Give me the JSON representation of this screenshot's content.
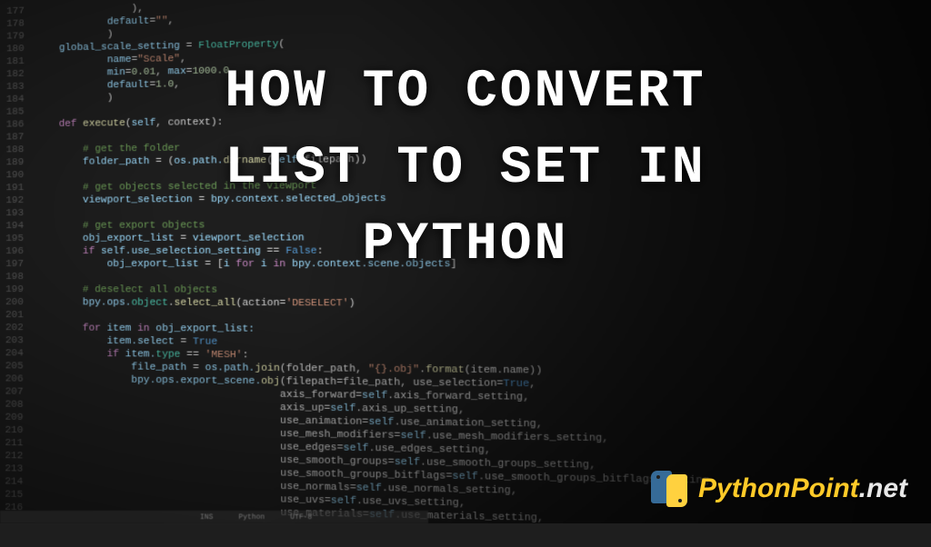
{
  "title": {
    "line1": "HOW TO CONVERT",
    "line2": "LIST TO SET IN",
    "line3": "PYTHON"
  },
  "logo": {
    "brand": "PythonPoint",
    "tld": ".net"
  },
  "statusbar": {
    "s1": "INS",
    "s2": "Python",
    "s3": "UTF-8"
  },
  "gutter": {
    "start": 177,
    "end": 216
  },
  "code": [
    {
      "i": 0,
      "tokens": [
        {
          "t": "                ",
          "c": ""
        },
        {
          "t": ")",
          "c": "op"
        },
        {
          "t": ",",
          "c": "op"
        }
      ]
    },
    {
      "i": 0,
      "tokens": [
        {
          "t": "            ",
          "c": ""
        },
        {
          "t": "default",
          "c": "prop"
        },
        {
          "t": "=",
          "c": "op"
        },
        {
          "t": "\"\"",
          "c": "str"
        },
        {
          "t": ",",
          "c": "op"
        }
      ]
    },
    {
      "i": 0,
      "tokens": [
        {
          "t": "            ",
          "c": ""
        },
        {
          "t": ")",
          "c": "op"
        }
      ]
    },
    {
      "i": 0,
      "tokens": [
        {
          "t": "    global_scale_setting ",
          "c": "prop"
        },
        {
          "t": "=",
          "c": "op"
        },
        {
          "t": " FloatProperty",
          "c": "type"
        },
        {
          "t": "(",
          "c": "op"
        }
      ]
    },
    {
      "i": 0,
      "tokens": [
        {
          "t": "            name",
          "c": "prop"
        },
        {
          "t": "=",
          "c": "op"
        },
        {
          "t": "\"Scale\"",
          "c": "str"
        },
        {
          "t": ",",
          "c": "op"
        }
      ]
    },
    {
      "i": 0,
      "tokens": [
        {
          "t": "            min",
          "c": "prop"
        },
        {
          "t": "=",
          "c": "op"
        },
        {
          "t": "0.01",
          "c": "num"
        },
        {
          "t": ", ",
          "c": "op"
        },
        {
          "t": "max",
          "c": "prop"
        },
        {
          "t": "=",
          "c": "op"
        },
        {
          "t": "1000.0",
          "c": "num"
        },
        {
          "t": ",",
          "c": "op"
        }
      ]
    },
    {
      "i": 0,
      "tokens": [
        {
          "t": "            default",
          "c": "prop"
        },
        {
          "t": "=",
          "c": "op"
        },
        {
          "t": "1.0",
          "c": "num"
        },
        {
          "t": ",",
          "c": "op"
        }
      ]
    },
    {
      "i": 0,
      "tokens": [
        {
          "t": "            )",
          "c": "op"
        }
      ]
    },
    {
      "i": 0,
      "tokens": [
        {
          "t": "",
          "c": ""
        }
      ]
    },
    {
      "i": 0,
      "tokens": [
        {
          "t": "    ",
          "c": ""
        },
        {
          "t": "def ",
          "c": "kw"
        },
        {
          "t": "execute",
          "c": "fn"
        },
        {
          "t": "(",
          "c": "op"
        },
        {
          "t": "self",
          "c": "self"
        },
        {
          "t": ", context):",
          "c": "op"
        }
      ]
    },
    {
      "i": 0,
      "tokens": [
        {
          "t": "",
          "c": ""
        }
      ]
    },
    {
      "i": 0,
      "tokens": [
        {
          "t": "        ",
          "c": ""
        },
        {
          "t": "# get the folder",
          "c": "com"
        }
      ]
    },
    {
      "i": 0,
      "tokens": [
        {
          "t": "        folder_path ",
          "c": "prop"
        },
        {
          "t": "= (",
          "c": "op"
        },
        {
          "t": "os.path.",
          "c": "prop"
        },
        {
          "t": "dirname",
          "c": "fn"
        },
        {
          "t": "(",
          "c": "op"
        },
        {
          "t": "self",
          "c": "self"
        },
        {
          "t": ".filepath))",
          "c": "op"
        }
      ]
    },
    {
      "i": 0,
      "tokens": [
        {
          "t": "",
          "c": ""
        }
      ]
    },
    {
      "i": 0,
      "tokens": [
        {
          "t": "        ",
          "c": ""
        },
        {
          "t": "# get objects selected in the viewport",
          "c": "com"
        }
      ]
    },
    {
      "i": 0,
      "tokens": [
        {
          "t": "        viewport_selection ",
          "c": "prop"
        },
        {
          "t": "= ",
          "c": "op"
        },
        {
          "t": "bpy.context.selected_objects",
          "c": "prop"
        }
      ]
    },
    {
      "i": 0,
      "tokens": [
        {
          "t": "",
          "c": ""
        }
      ]
    },
    {
      "i": 0,
      "tokens": [
        {
          "t": "        ",
          "c": ""
        },
        {
          "t": "# get export objects",
          "c": "com"
        }
      ]
    },
    {
      "i": 0,
      "tokens": [
        {
          "t": "        obj_export_list ",
          "c": "prop"
        },
        {
          "t": "= ",
          "c": "op"
        },
        {
          "t": "viewport_selection",
          "c": "prop"
        }
      ]
    },
    {
      "i": 0,
      "tokens": [
        {
          "t": "        ",
          "c": ""
        },
        {
          "t": "if ",
          "c": "kw"
        },
        {
          "t": "self",
          "c": "self"
        },
        {
          "t": ".use_selection_setting ",
          "c": "prop"
        },
        {
          "t": "== ",
          "c": "op"
        },
        {
          "t": "False",
          "c": "bool"
        },
        {
          "t": ":",
          "c": "op"
        }
      ]
    },
    {
      "i": 0,
      "tokens": [
        {
          "t": "            obj_export_list ",
          "c": "prop"
        },
        {
          "t": "= [",
          "c": "op"
        },
        {
          "t": "i ",
          "c": "prop"
        },
        {
          "t": "for ",
          "c": "kw"
        },
        {
          "t": "i ",
          "c": "prop"
        },
        {
          "t": "in ",
          "c": "kw"
        },
        {
          "t": "bpy.context.scene.objects",
          "c": "prop"
        },
        {
          "t": "]",
          "c": "op"
        }
      ]
    },
    {
      "i": 0,
      "tokens": [
        {
          "t": "",
          "c": ""
        }
      ]
    },
    {
      "i": 0,
      "tokens": [
        {
          "t": "        ",
          "c": ""
        },
        {
          "t": "# deselect all objects",
          "c": "com"
        }
      ]
    },
    {
      "i": 0,
      "tokens": [
        {
          "t": "        bpy.ops.",
          "c": "prop"
        },
        {
          "t": "object",
          "c": "type"
        },
        {
          "t": ".",
          "c": "op"
        },
        {
          "t": "select_all",
          "c": "fn"
        },
        {
          "t": "(action=",
          "c": "op"
        },
        {
          "t": "'DESELECT'",
          "c": "str"
        },
        {
          "t": ")",
          "c": "op"
        }
      ]
    },
    {
      "i": 0,
      "tokens": [
        {
          "t": "",
          "c": ""
        }
      ]
    },
    {
      "i": 0,
      "tokens": [
        {
          "t": "        ",
          "c": ""
        },
        {
          "t": "for ",
          "c": "kw"
        },
        {
          "t": "item ",
          "c": "prop"
        },
        {
          "t": "in ",
          "c": "kw"
        },
        {
          "t": "obj_export_list:",
          "c": "prop"
        }
      ]
    },
    {
      "i": 0,
      "tokens": [
        {
          "t": "            item.select ",
          "c": "prop"
        },
        {
          "t": "= ",
          "c": "op"
        },
        {
          "t": "True",
          "c": "bool"
        }
      ]
    },
    {
      "i": 0,
      "tokens": [
        {
          "t": "            ",
          "c": ""
        },
        {
          "t": "if ",
          "c": "kw"
        },
        {
          "t": "item.",
          "c": "prop"
        },
        {
          "t": "type",
          "c": "type"
        },
        {
          "t": " == ",
          "c": "op"
        },
        {
          "t": "'MESH'",
          "c": "str"
        },
        {
          "t": ":",
          "c": "op"
        }
      ]
    },
    {
      "i": 0,
      "tokens": [
        {
          "t": "                file_path ",
          "c": "prop"
        },
        {
          "t": "= ",
          "c": "op"
        },
        {
          "t": "os.path.",
          "c": "prop"
        },
        {
          "t": "join",
          "c": "fn"
        },
        {
          "t": "(folder_path, ",
          "c": "op"
        },
        {
          "t": "\"{}.obj\"",
          "c": "str"
        },
        {
          "t": ".",
          "c": "op"
        },
        {
          "t": "format",
          "c": "fn"
        },
        {
          "t": "(item.name))",
          "c": "op"
        }
      ]
    },
    {
      "i": 0,
      "tokens": [
        {
          "t": "                bpy.ops.export_scene.",
          "c": "prop"
        },
        {
          "t": "obj",
          "c": "fn"
        },
        {
          "t": "(filepath=file_path, use_selection=",
          "c": "op"
        },
        {
          "t": "True",
          "c": "bool"
        },
        {
          "t": ",",
          "c": "op"
        }
      ]
    },
    {
      "i": 0,
      "tokens": [
        {
          "t": "                                        axis_forward=",
          "c": "op"
        },
        {
          "t": "self",
          "c": "self"
        },
        {
          "t": ".axis_forward_setting,",
          "c": "op"
        }
      ]
    },
    {
      "i": 0,
      "tokens": [
        {
          "t": "                                        axis_up=",
          "c": "op"
        },
        {
          "t": "self",
          "c": "self"
        },
        {
          "t": ".axis_up_setting,",
          "c": "op"
        }
      ]
    },
    {
      "i": 0,
      "tokens": [
        {
          "t": "                                        use_animation=",
          "c": "op"
        },
        {
          "t": "self",
          "c": "self"
        },
        {
          "t": ".use_animation_setting,",
          "c": "op"
        }
      ]
    },
    {
      "i": 0,
      "tokens": [
        {
          "t": "                                        use_mesh_modifiers=",
          "c": "op"
        },
        {
          "t": "self",
          "c": "self"
        },
        {
          "t": ".use_mesh_modifiers_setting,",
          "c": "op"
        }
      ]
    },
    {
      "i": 0,
      "tokens": [
        {
          "t": "                                        use_edges=",
          "c": "op"
        },
        {
          "t": "self",
          "c": "self"
        },
        {
          "t": ".use_edges_setting,",
          "c": "op"
        }
      ]
    },
    {
      "i": 0,
      "tokens": [
        {
          "t": "                                        use_smooth_groups=",
          "c": "op"
        },
        {
          "t": "self",
          "c": "self"
        },
        {
          "t": ".use_smooth_groups_setting,",
          "c": "op"
        }
      ]
    },
    {
      "i": 0,
      "tokens": [
        {
          "t": "                                        use_smooth_groups_bitflags=",
          "c": "op"
        },
        {
          "t": "self",
          "c": "self"
        },
        {
          "t": ".use_smooth_groups_bitflags_setting,",
          "c": "op"
        }
      ]
    },
    {
      "i": 0,
      "tokens": [
        {
          "t": "                                        use_normals=",
          "c": "op"
        },
        {
          "t": "self",
          "c": "self"
        },
        {
          "t": ".use_normals_setting,",
          "c": "op"
        }
      ]
    },
    {
      "i": 0,
      "tokens": [
        {
          "t": "                                        use_uvs=",
          "c": "op"
        },
        {
          "t": "self",
          "c": "self"
        },
        {
          "t": ".use_uvs_setting,",
          "c": "op"
        }
      ]
    },
    {
      "i": 0,
      "tokens": [
        {
          "t": "                                        use_materials=",
          "c": "op"
        },
        {
          "t": "self",
          "c": "self"
        },
        {
          "t": ".use_materials_setting,",
          "c": "op"
        }
      ]
    }
  ]
}
